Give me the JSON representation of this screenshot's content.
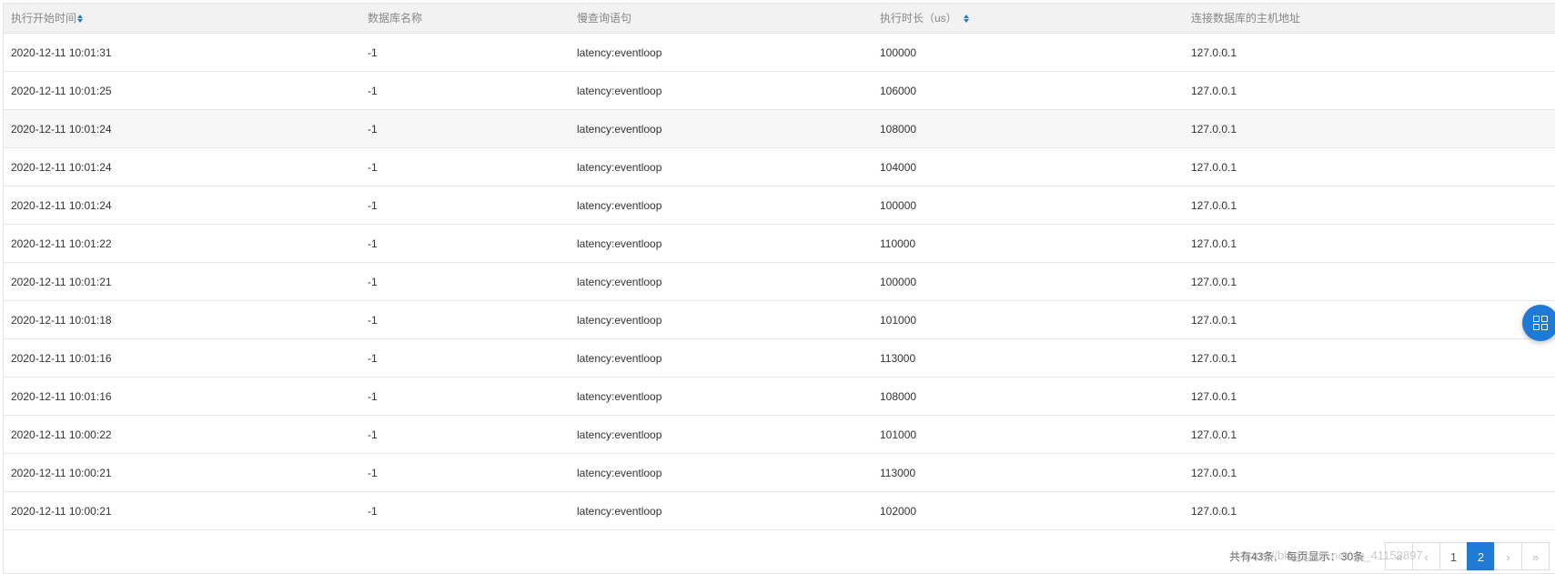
{
  "table": {
    "headers": [
      "执行开始时间",
      "数据库名称",
      "慢查询语句",
      "执行时长（us）",
      "连接数据库的主机地址"
    ],
    "rows": [
      [
        "2020-12-11 10:01:31",
        "-1",
        "latency:eventloop",
        "100000",
        "127.0.0.1"
      ],
      [
        "2020-12-11 10:01:25",
        "-1",
        "latency:eventloop",
        "106000",
        "127.0.0.1"
      ],
      [
        "2020-12-11 10:01:24",
        "-1",
        "latency:eventloop",
        "108000",
        "127.0.0.1"
      ],
      [
        "2020-12-11 10:01:24",
        "-1",
        "latency:eventloop",
        "104000",
        "127.0.0.1"
      ],
      [
        "2020-12-11 10:01:24",
        "-1",
        "latency:eventloop",
        "100000",
        "127.0.0.1"
      ],
      [
        "2020-12-11 10:01:22",
        "-1",
        "latency:eventloop",
        "110000",
        "127.0.0.1"
      ],
      [
        "2020-12-11 10:01:21",
        "-1",
        "latency:eventloop",
        "100000",
        "127.0.0.1"
      ],
      [
        "2020-12-11 10:01:18",
        "-1",
        "latency:eventloop",
        "101000",
        "127.0.0.1"
      ],
      [
        "2020-12-11 10:01:16",
        "-1",
        "latency:eventloop",
        "113000",
        "127.0.0.1"
      ],
      [
        "2020-12-11 10:01:16",
        "-1",
        "latency:eventloop",
        "108000",
        "127.0.0.1"
      ],
      [
        "2020-12-11 10:00:22",
        "-1",
        "latency:eventloop",
        "101000",
        "127.0.0.1"
      ],
      [
        "2020-12-11 10:00:21",
        "-1",
        "latency:eventloop",
        "113000",
        "127.0.0.1"
      ],
      [
        "2020-12-11 10:00:21",
        "-1",
        "latency:eventloop",
        "102000",
        "127.0.0.1"
      ]
    ]
  },
  "pagination": {
    "total_text": "共有43条,",
    "page_size_text": "每页显示：30条",
    "first": "«",
    "prev": "‹",
    "page1": "1",
    "page2": "2",
    "next": "›",
    "last": "»"
  },
  "watermark": "https://blog.csdn.net/qq_41153897",
  "icons": {
    "sort": "sort-icon",
    "float": "grid-menu-icon"
  },
  "colors": {
    "accent": "#1f7ad6",
    "header_bg": "#f2f2f2"
  }
}
